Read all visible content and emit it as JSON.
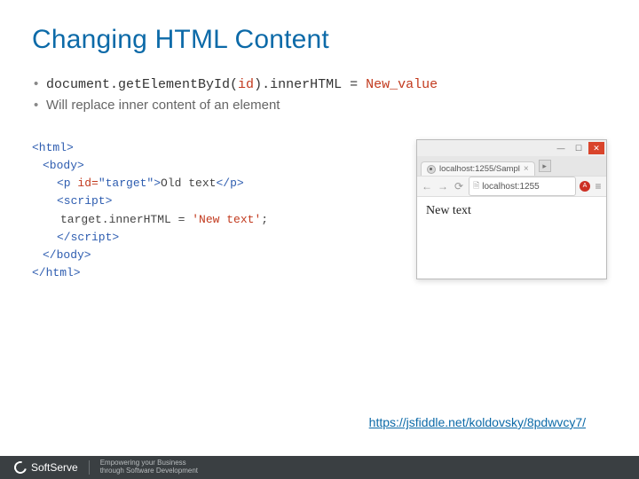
{
  "title": "Changing HTML Content",
  "bullets": {
    "b1": {
      "pre": "document.getElementById(",
      "id": "id",
      "mid": ").innerHTML = ",
      "val": "New_value"
    },
    "b2": "Will replace inner content of an element"
  },
  "code": {
    "l1a": "<html>",
    "l2a": "<body>",
    "l3a": "<p ",
    "l3b": "id=",
    "l3c": "\"target\"",
    "l3d": ">",
    "l3e": "Old text",
    "l3f": "</p>",
    "l4a": "<script>",
    "l5a": "target.innerHTML = ",
    "l5b": "'New text'",
    "l5c": ";",
    "l6a": "</script>",
    "l7a": "</body>",
    "l8a": "</html>"
  },
  "browser": {
    "tab_label": "localhost:1255/Sampl",
    "url": "localhost:1255",
    "content": "New text"
  },
  "link": "https://jsfiddle.net/koldovsky/8pdwvcy7/",
  "footer": {
    "brand": "SoftServe",
    "tag1": "Empowering your Business",
    "tag2": "through Software Development"
  }
}
